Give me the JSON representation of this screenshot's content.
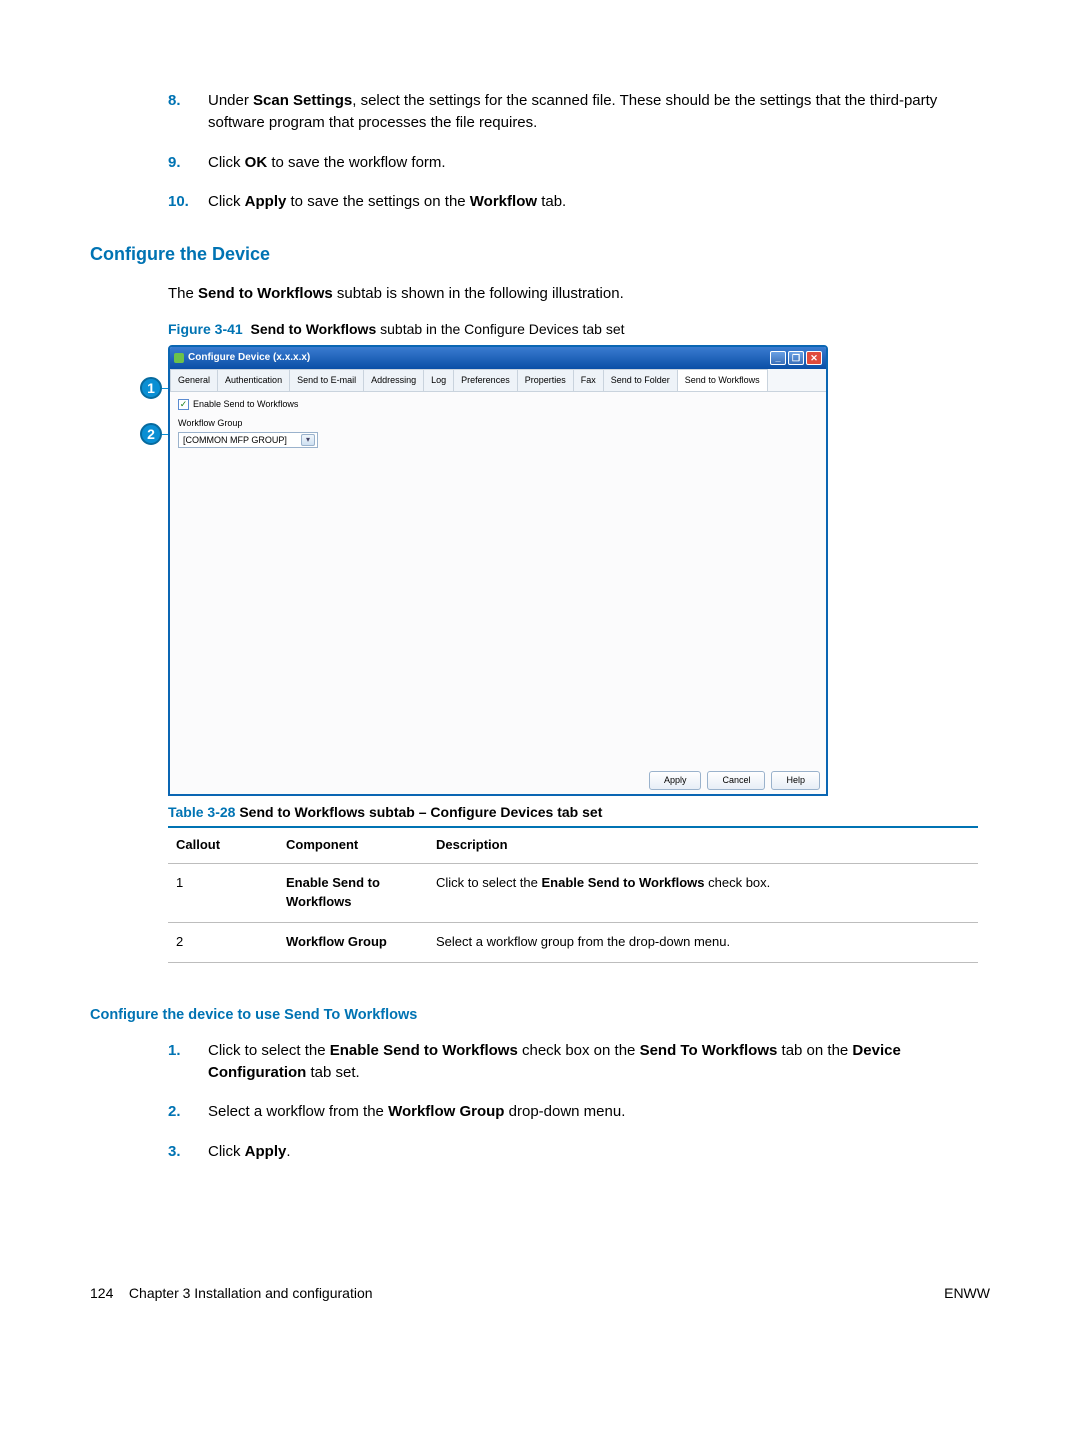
{
  "steps_a": [
    {
      "num": "8.",
      "pre": "Under ",
      "b1": "Scan Settings",
      "post": ", select the settings for the scanned file. These should be the settings that the third-party software program that processes the file requires."
    },
    {
      "num": "9.",
      "pre": "Click ",
      "b1": "OK",
      "post": " to save the workflow form."
    },
    {
      "num": "10.",
      "pre": "Click ",
      "b1": "Apply",
      "mid": " to save the settings on the ",
      "b2": "Workflow",
      "post": " tab."
    }
  ],
  "heading_configure": "Configure the Device",
  "para1_pre": "The ",
  "para1_b": "Send to Workflows",
  "para1_post": " subtab is shown in the following illustration.",
  "fig_lead": "Figure 3-41",
  "fig_bold": "Send to Workflows",
  "fig_rest": " subtab in the Configure Devices tab set",
  "shot": {
    "title": "Configure Device (x.x.x.x)",
    "tabs": [
      "General",
      "Authentication",
      "Send to E-mail",
      "Addressing",
      "Log",
      "Preferences",
      "Properties",
      "Fax",
      "Send to Folder",
      "Send to Workflows"
    ],
    "enable_label": "Enable Send to Workflows",
    "wg_label": "Workflow Group",
    "wg_value": "[COMMON MFP GROUP]",
    "apply": "Apply",
    "cancel": "Cancel",
    "help": "Help",
    "min_icon": "_",
    "max_icon": "❐",
    "close_icon": "✕",
    "check_glyph": "✓",
    "dd_glyph": "▾"
  },
  "callouts": {
    "one": "1",
    "two": "2"
  },
  "tbl_lead": "Table 3-28",
  "tbl_bold": "Send to Workflows subtab – Configure Devices tab set",
  "tbl_headers": {
    "c": "Callout",
    "comp": "Component",
    "desc": "Description"
  },
  "tbl_rows": [
    {
      "c": "1",
      "comp": "Enable Send to Workflows",
      "desc_pre": "Click to select the ",
      "desc_b": "Enable Send to Workflows",
      "desc_post": " check box."
    },
    {
      "c": "2",
      "comp": "Workflow Group",
      "desc_pre": "Select a workflow group from the drop-down menu.",
      "desc_b": "",
      "desc_post": ""
    }
  ],
  "h4": "Configure the device to use Send To Workflows",
  "steps_b": [
    {
      "num": "1.",
      "pre": "Click to select the ",
      "b1": "Enable Send to Workflows",
      "mid": " check box on the ",
      "b2": "Send To Workflows",
      "mid2": " tab on the ",
      "b3": "Device Configuration",
      "post": " tab set."
    },
    {
      "num": "2.",
      "pre": "Select a workflow from the ",
      "b1": "Workflow Group",
      "post": " drop-down menu."
    },
    {
      "num": "3.",
      "pre": "Click ",
      "b1": "Apply",
      "post": "."
    }
  ],
  "footer": {
    "page": "124",
    "chapter": "Chapter 3   Installation and configuration",
    "right": "ENWW"
  }
}
